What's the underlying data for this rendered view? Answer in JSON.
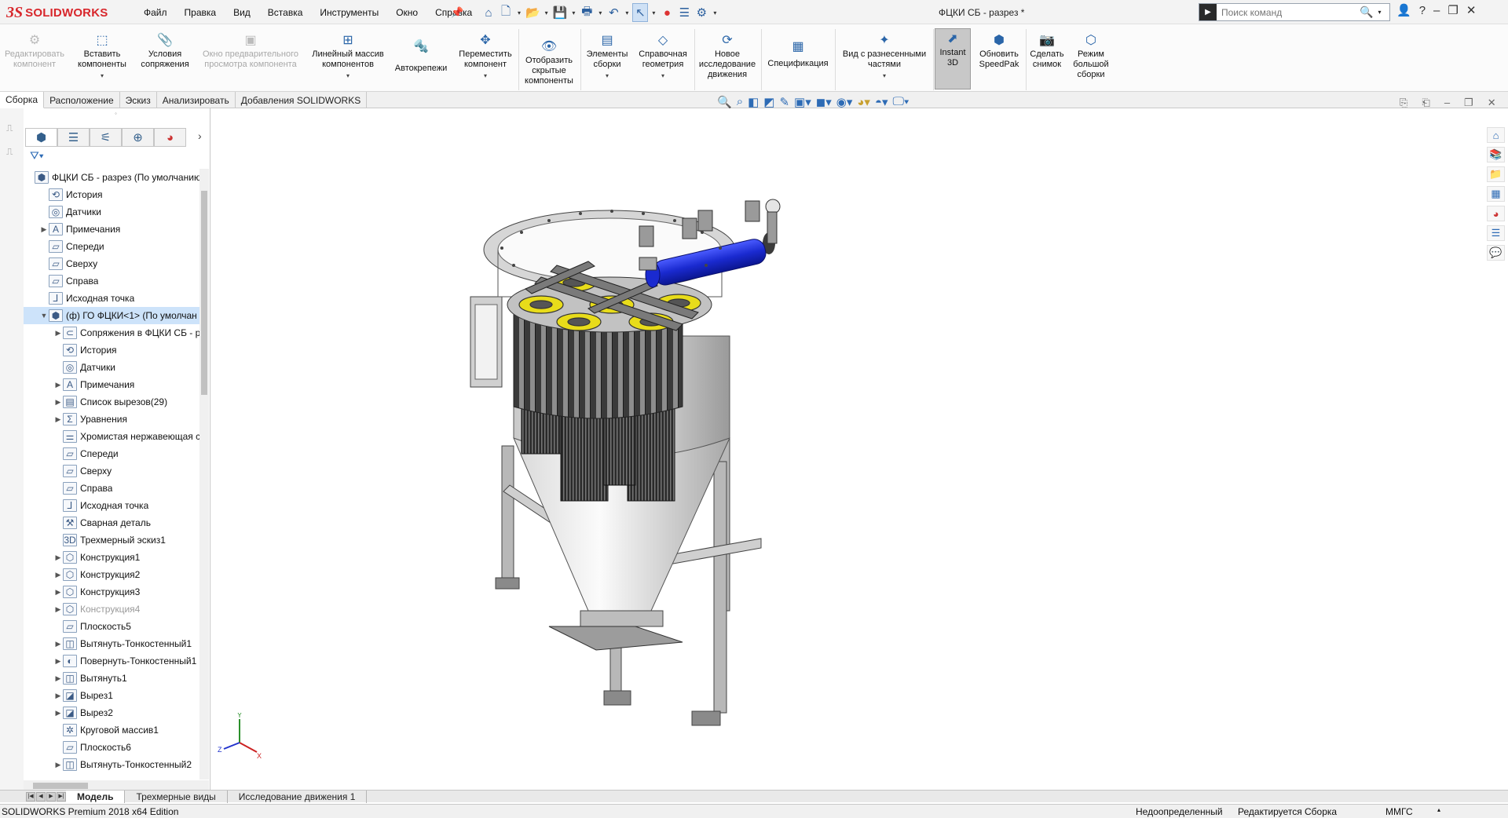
{
  "app": {
    "logo_prefix": "3S",
    "logo_name": "SOLIDWORKS"
  },
  "menu": [
    "Файл",
    "Правка",
    "Вид",
    "Вставка",
    "Инструменты",
    "Окно",
    "Справка"
  ],
  "document_title": "ФЦКИ СБ - разрез *",
  "search": {
    "placeholder": "Поиск команд"
  },
  "commands": [
    {
      "label": "Редактировать компонент",
      "icon": "edit-component-icon",
      "disabled": true
    },
    {
      "label": "Вставить компоненты",
      "icon": "insert-components-icon"
    },
    {
      "label": "Условия сопряжения",
      "icon": "mate-icon"
    },
    {
      "label": "Окно предварительного просмотра компонента",
      "icon": "preview-window-icon",
      "disabled": true
    },
    {
      "label": "Линейный массив компонентов",
      "icon": "linear-pattern-icon"
    },
    {
      "label": "Автокрепежи",
      "icon": "smart-fasteners-icon"
    },
    {
      "label": "Переместить компонент",
      "icon": "move-component-icon"
    },
    {
      "label": "Отобразить скрытые компоненты",
      "icon": "show-hidden-icon"
    },
    {
      "label": "Элементы сборки",
      "icon": "assembly-features-icon"
    },
    {
      "label": "Справочная геометрия",
      "icon": "reference-geometry-icon"
    },
    {
      "label": "Новое исследование движения",
      "icon": "motion-study-icon"
    },
    {
      "label": "Спецификация",
      "icon": "bom-icon"
    },
    {
      "label": "Вид с разнесенными частями",
      "icon": "exploded-view-icon"
    },
    {
      "label": "Instant 3D",
      "icon": "instant3d-icon",
      "active": true
    },
    {
      "label": "Обновить SpeedPak",
      "icon": "speedpak-icon"
    },
    {
      "label": "Сделать снимок",
      "icon": "snapshot-icon"
    },
    {
      "label": "Режим большой сборки",
      "icon": "large-assembly-icon"
    }
  ],
  "ribbon_tabs": [
    "Сборка",
    "Расположение",
    "Эскиз",
    "Анализировать",
    "Добавления SOLIDWORKS"
  ],
  "tree": [
    {
      "label": "ФЦКИ СБ - разрез  (По умолчанию",
      "level": 0,
      "twisty": "",
      "icon": "assembly-icon"
    },
    {
      "label": "История",
      "level": 1,
      "twisty": "",
      "icon": "history-icon"
    },
    {
      "label": "Датчики",
      "level": 1,
      "twisty": "",
      "icon": "sensor-icon"
    },
    {
      "label": "Примечания",
      "level": 1,
      "twisty": "▶",
      "icon": "annotations-icon"
    },
    {
      "label": "Спереди",
      "level": 1,
      "twisty": "",
      "icon": "plane-icon"
    },
    {
      "label": "Сверху",
      "level": 1,
      "twisty": "",
      "icon": "plane-icon"
    },
    {
      "label": "Справа",
      "level": 1,
      "twisty": "",
      "icon": "plane-icon"
    },
    {
      "label": "Исходная точка",
      "level": 1,
      "twisty": "",
      "icon": "origin-icon"
    },
    {
      "label": "(ф) ГО ФЦКИ<1> (По умолчан",
      "level": 1,
      "twisty": "▼",
      "icon": "part-icon",
      "selected": true
    },
    {
      "label": "Сопряжения в ФЦКИ СБ - р",
      "level": 2,
      "twisty": "▶",
      "icon": "mates-icon"
    },
    {
      "label": "История",
      "level": 2,
      "twisty": "",
      "icon": "history-icon"
    },
    {
      "label": "Датчики",
      "level": 2,
      "twisty": "",
      "icon": "sensor-icon"
    },
    {
      "label": "Примечания",
      "level": 2,
      "twisty": "▶",
      "icon": "annotations-icon"
    },
    {
      "label": "Список вырезов(29)",
      "level": 2,
      "twisty": "▶",
      "icon": "cut-list-icon"
    },
    {
      "label": "Уравнения",
      "level": 2,
      "twisty": "▶",
      "icon": "equations-icon"
    },
    {
      "label": "Хромистая нержавеющая с",
      "level": 2,
      "twisty": "",
      "icon": "material-icon"
    },
    {
      "label": "Спереди",
      "level": 2,
      "twisty": "",
      "icon": "plane-icon"
    },
    {
      "label": "Сверху",
      "level": 2,
      "twisty": "",
      "icon": "plane-icon"
    },
    {
      "label": "Справа",
      "level": 2,
      "twisty": "",
      "icon": "plane-icon"
    },
    {
      "label": "Исходная точка",
      "level": 2,
      "twisty": "",
      "icon": "origin-icon"
    },
    {
      "label": "Сварная деталь",
      "level": 2,
      "twisty": "",
      "icon": "weldment-icon"
    },
    {
      "label": "Трехмерный эскиз1",
      "level": 2,
      "twisty": "",
      "icon": "sketch3d-icon"
    },
    {
      "label": "Конструкция1",
      "level": 2,
      "twisty": "▶",
      "icon": "structure-icon"
    },
    {
      "label": "Конструкция2",
      "level": 2,
      "twisty": "▶",
      "icon": "structure-icon"
    },
    {
      "label": "Конструкция3",
      "level": 2,
      "twisty": "▶",
      "icon": "structure-icon"
    },
    {
      "label": "Конструкция4",
      "level": 2,
      "twisty": "▶",
      "icon": "structure-icon",
      "grey": true
    },
    {
      "label": "Плоскость5",
      "level": 2,
      "twisty": "",
      "icon": "plane-icon"
    },
    {
      "label": "Вытянуть-Тонкостенный1",
      "level": 2,
      "twisty": "▶",
      "icon": "extrude-icon"
    },
    {
      "label": "Повернуть-Тонкостенный1",
      "level": 2,
      "twisty": "▶",
      "icon": "revolve-icon"
    },
    {
      "label": "Вытянуть1",
      "level": 2,
      "twisty": "▶",
      "icon": "extrude-icon"
    },
    {
      "label": "Вырез1",
      "level": 2,
      "twisty": "▶",
      "icon": "cut-icon"
    },
    {
      "label": "Вырез2",
      "level": 2,
      "twisty": "▶",
      "icon": "cut-icon"
    },
    {
      "label": "Круговой массив1",
      "level": 2,
      "twisty": "",
      "icon": "circular-pattern-icon"
    },
    {
      "label": "Плоскость6",
      "level": 2,
      "twisty": "",
      "icon": "plane-icon"
    },
    {
      "label": "Вытянуть-Тонкостенный2",
      "level": 2,
      "twisty": "▶",
      "icon": "extrude-icon"
    }
  ],
  "bottom_tabs": [
    "Модель",
    "Трехмерные виды",
    "Исследование движения 1"
  ],
  "status": {
    "edition": "SOLIDWORKS Premium 2018 x64 Edition",
    "definition": "Недоопределенный",
    "editing": "Редактируется Сборка",
    "units": "ММГС"
  },
  "colors": {
    "brand": "#d8262b",
    "accent_blue": "#2233cc",
    "filter_yellow": "#e8dc1a"
  }
}
